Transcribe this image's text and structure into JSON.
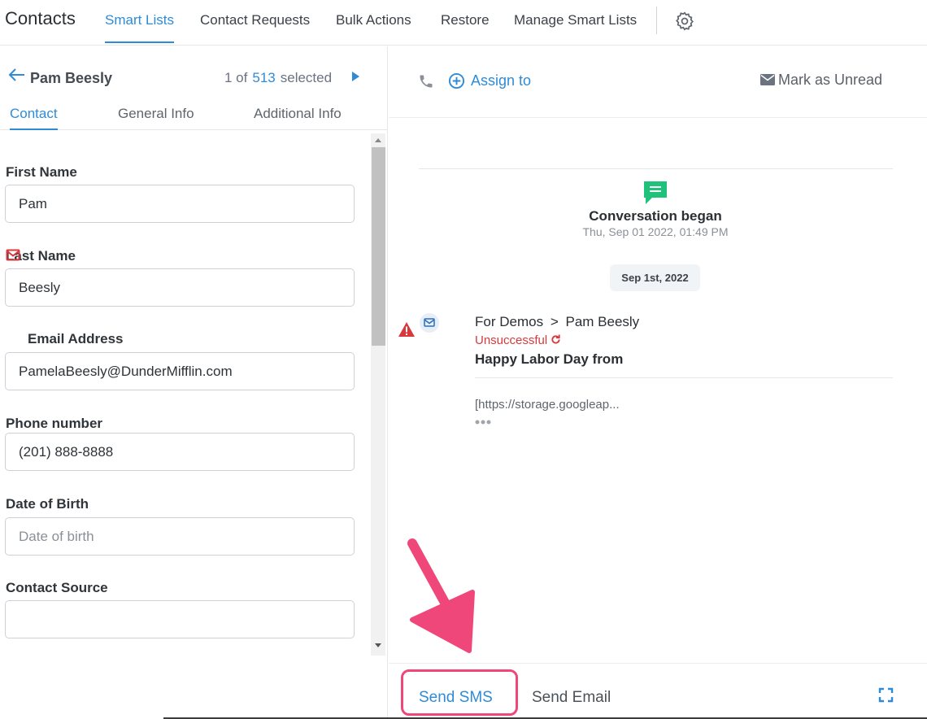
{
  "nav": {
    "brand": "Contacts",
    "tabs": [
      {
        "label": "Smart Lists",
        "active": true
      },
      {
        "label": "Contact Requests"
      },
      {
        "label": "Bulk Actions"
      },
      {
        "label": "Restore"
      },
      {
        "label": "Manage Smart Lists"
      }
    ],
    "settings_icon": "gear-icon"
  },
  "contact": {
    "name": "Pam Beesly",
    "position_prefix": "1 of",
    "total": "513",
    "position_suffix": "selected",
    "tabs": [
      {
        "label": "Contact",
        "active": true
      },
      {
        "label": "General Info"
      },
      {
        "label": "Additional Info"
      }
    ],
    "fields": [
      {
        "label": "First Name",
        "value": "Pam"
      },
      {
        "label": "Last Name",
        "value": "Beesly"
      },
      {
        "label": "Email Address",
        "value": "PamelaBeesly@DunderMifflin.com",
        "icon": "mail-icon"
      },
      {
        "label": "Phone number",
        "value": "(201) 888-8888"
      },
      {
        "label": "Date of Birth",
        "value": "",
        "placeholder": "Date of birth"
      },
      {
        "label": "Contact Source",
        "value": ""
      }
    ]
  },
  "conversation": {
    "assign_label": "Assign to",
    "mark_unread_label": "Mark as Unread",
    "began_title": "Conversation began",
    "began_date": "Thu, Sep 01 2022, 01:49 PM",
    "date_pill": "Sep 1st, 2022",
    "message": {
      "from": "For Demos",
      "separator": ">",
      "to": "Pam Beesly",
      "status": "Unsuccessful",
      "subject": "Happy Labor Day from",
      "preview": "[https://storage.googleap..."
    }
  },
  "composer": {
    "send_sms_label": "Send SMS",
    "send_email_label": "Send Email"
  },
  "colors": {
    "accent": "#2f8bd6",
    "error": "#d9383d",
    "highlight": "#f0477a",
    "chat_green": "#1fc27a"
  }
}
